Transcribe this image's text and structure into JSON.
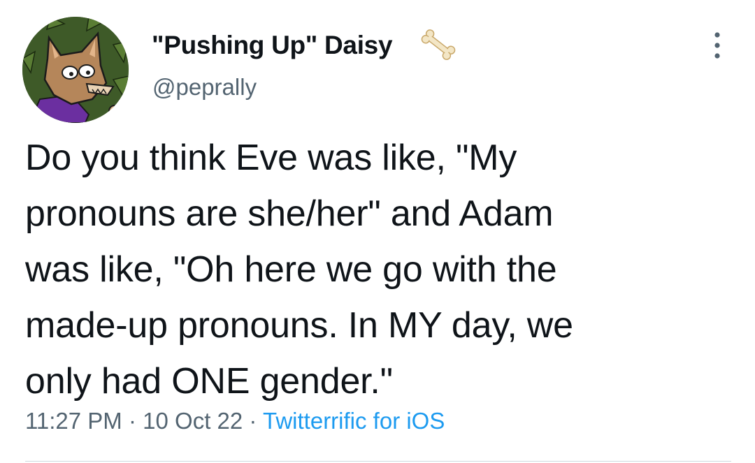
{
  "tweet": {
    "author": {
      "display_name": "\"Pushing Up\" Daisy",
      "name_emoji_icon": "bone-icon",
      "handle": "@peprally",
      "avatar_icon": "fox-avatar-icon"
    },
    "more_options_icon": "three-dots-vertical-icon",
    "text": "Do you think Eve was like, \"My\npronouns are she/her\" and Adam\nwas like, \"Oh here we go with the\nmade-up pronouns. In MY day, we\nonly had ONE gender.\"",
    "time": "11:27 PM",
    "date": "10 Oct 22",
    "separator": "·",
    "source": "Twitterrific for iOS"
  },
  "colors": {
    "text": "#0f1419",
    "secondary": "#536471",
    "link": "#1d9bf0",
    "divider": "#cfd9de"
  }
}
